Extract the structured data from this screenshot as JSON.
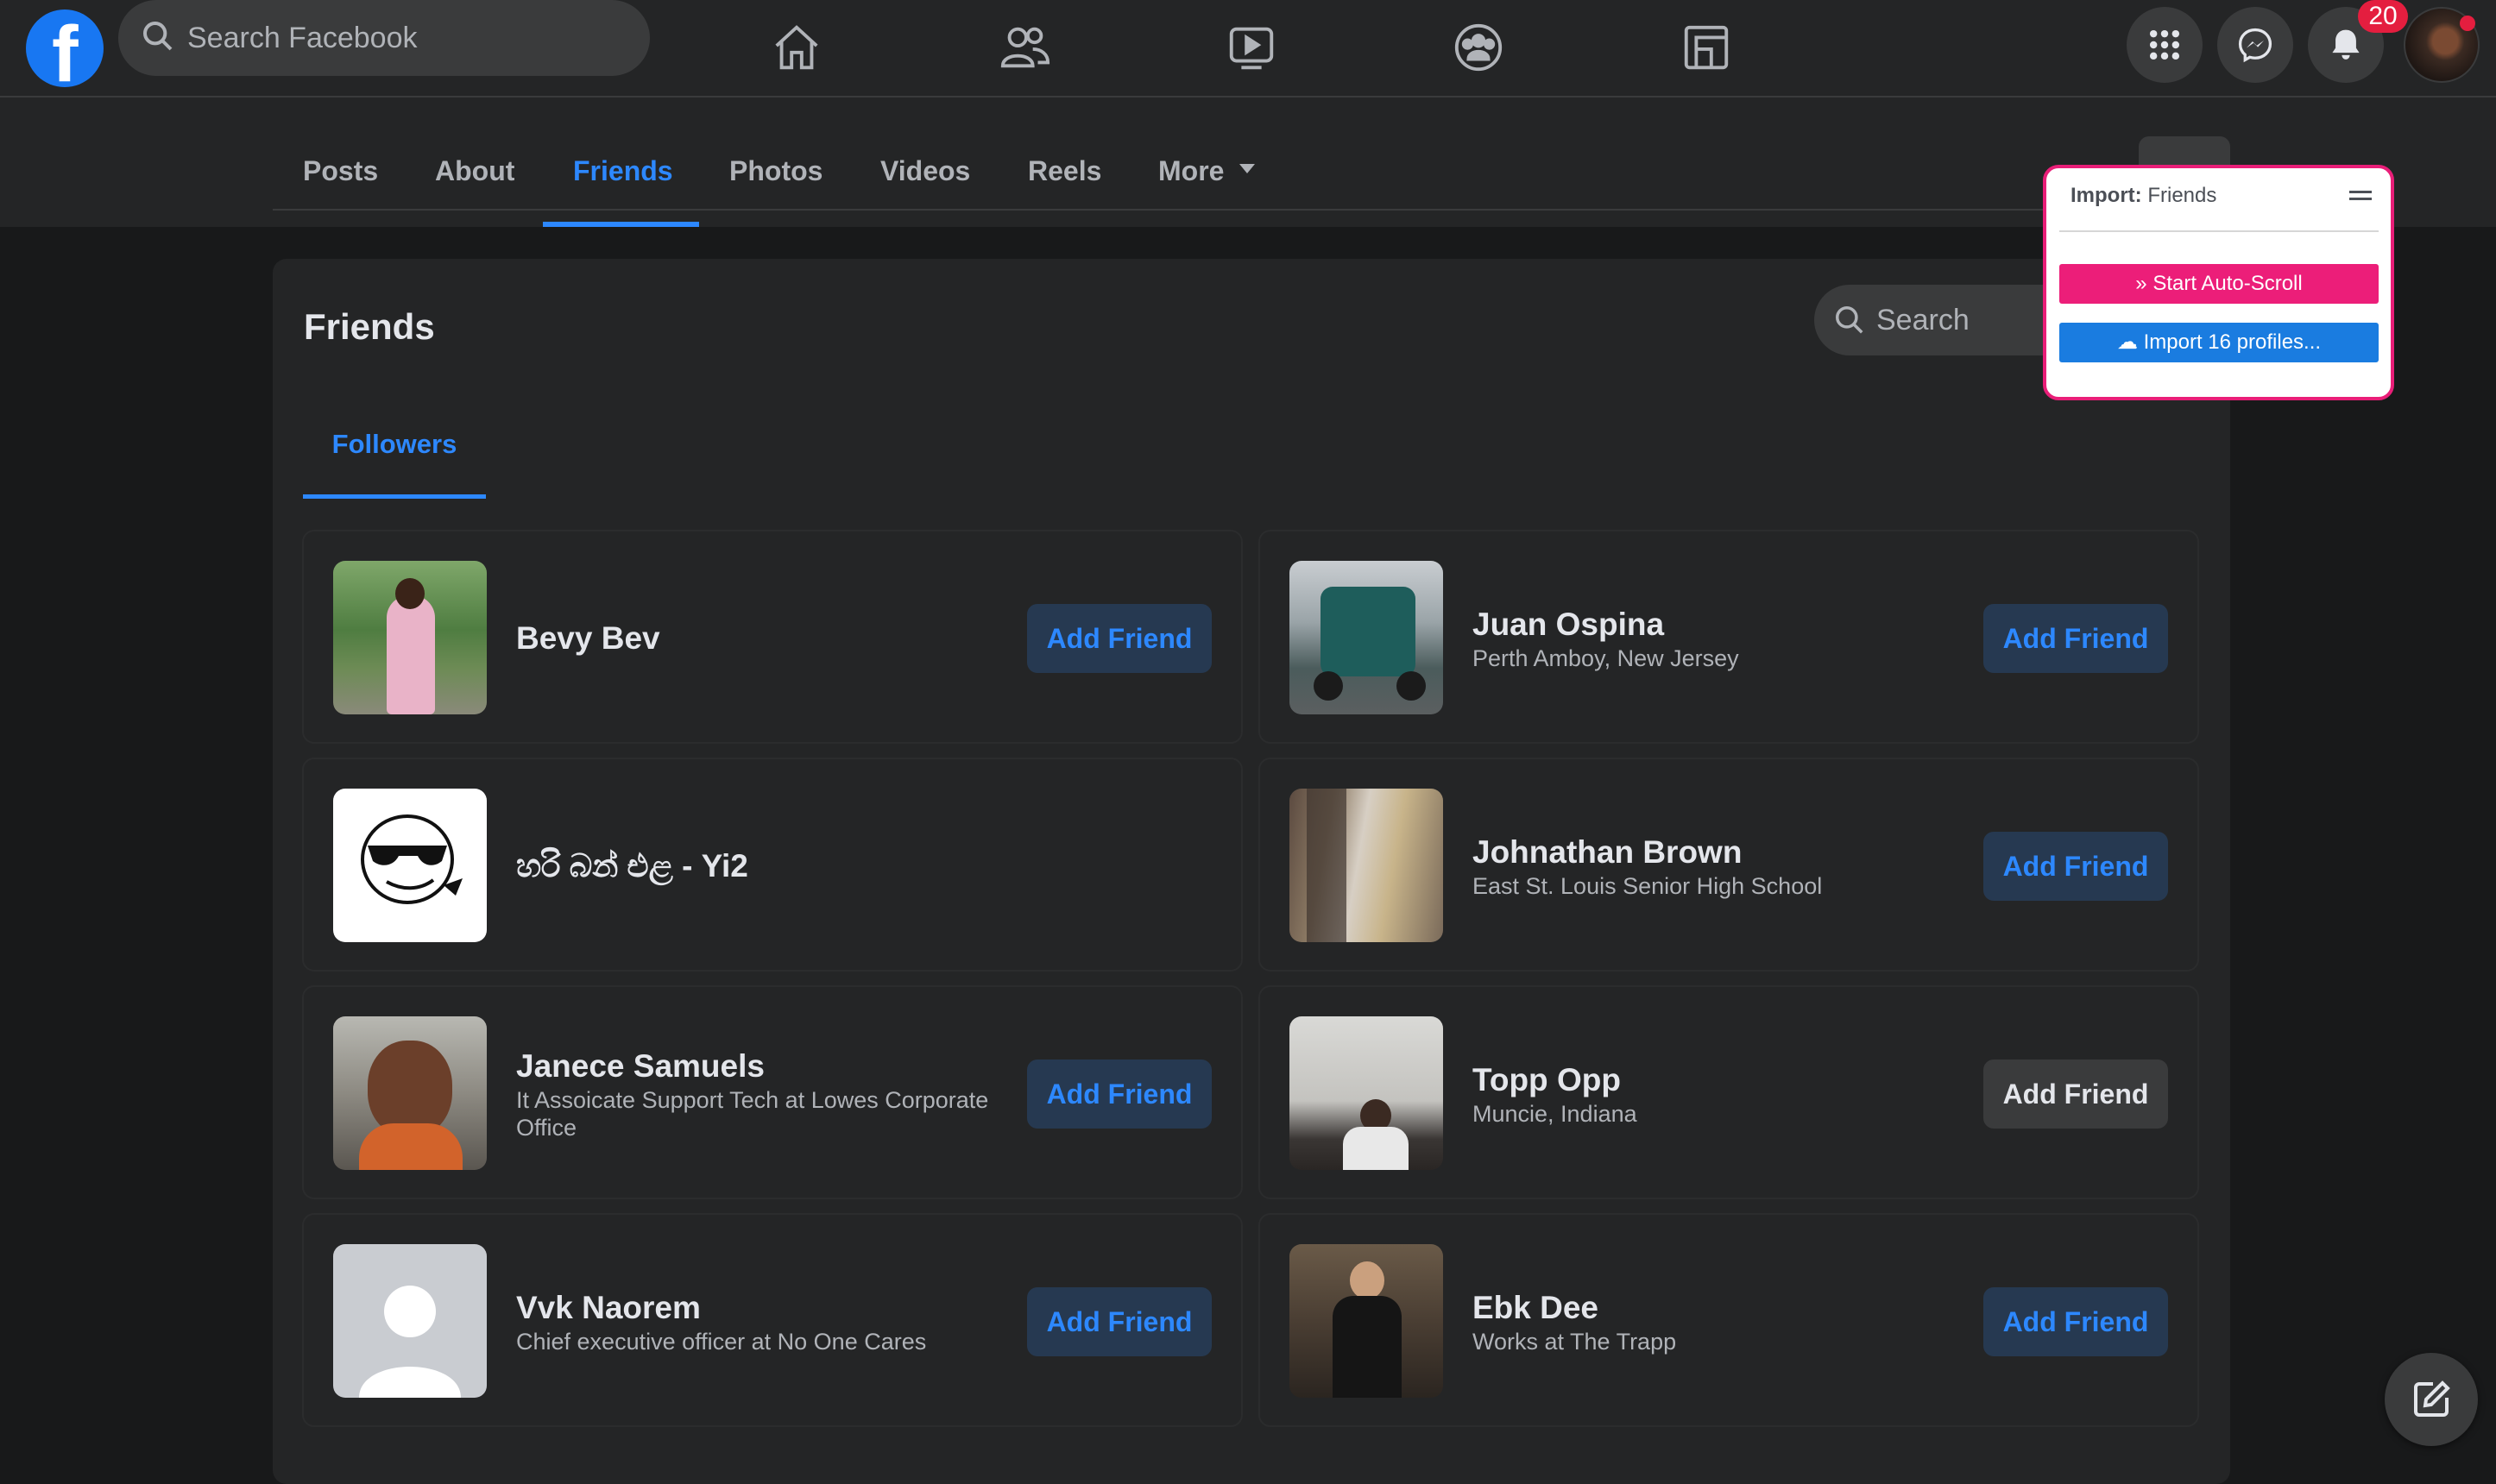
{
  "top_bar": {
    "logo_letter": "f",
    "search_placeholder": "Search Facebook",
    "nav_icons": [
      "home-icon",
      "friends-icon",
      "watch-icon",
      "groups-icon",
      "gaming-icon"
    ],
    "right_icons": [
      "menu-grid-icon",
      "messenger-icon",
      "bell-icon"
    ],
    "notification_count": "20"
  },
  "profile_tabs": [
    {
      "label": "Posts",
      "active": false
    },
    {
      "label": "About",
      "active": false
    },
    {
      "label": "Friends",
      "active": true
    },
    {
      "label": "Photos",
      "active": false
    },
    {
      "label": "Videos",
      "active": false
    },
    {
      "label": "Reels",
      "active": false
    },
    {
      "label": "More",
      "active": false
    }
  ],
  "friends": {
    "title": "Friends",
    "search_placeholder": "Search",
    "subtab": "Followers",
    "cards": [
      {
        "name": "Bevy Bev",
        "subtitle": "",
        "button": "Add Friend"
      },
      {
        "name": "Juan Ospina",
        "subtitle": "Perth Amboy, New Jersey",
        "button": "Add Friend"
      },
      {
        "name": "හරි බන් එළ - Yi2",
        "subtitle": "",
        "button": ""
      },
      {
        "name": "Johnathan Brown",
        "subtitle": "East St. Louis Senior High School",
        "button": "Add Friend"
      },
      {
        "name": "Janece Samuels",
        "subtitle": "It Assoicate Support Tech at Lowes Corporate Office",
        "button": "Add Friend"
      },
      {
        "name": "Topp Opp",
        "subtitle": "Muncie, Indiana",
        "button": "Add Friend"
      },
      {
        "name": "Vvk Naorem",
        "subtitle": "Chief executive officer at No One Cares",
        "button": "Add Friend"
      },
      {
        "name": "Ebk Dee",
        "subtitle": "Works at The Trapp",
        "button": "Add Friend"
      }
    ]
  },
  "import_popup": {
    "title_prefix": "Import:",
    "title_target": "Friends",
    "autoscroll_label": "Start Auto-Scroll",
    "import_label": "Import 16 profiles..."
  },
  "colors": {
    "accent_blue": "#2d88ff",
    "popup_pink": "#ec1e79",
    "popup_blue": "#1a7ce0",
    "badge_red": "#e41e3f"
  }
}
